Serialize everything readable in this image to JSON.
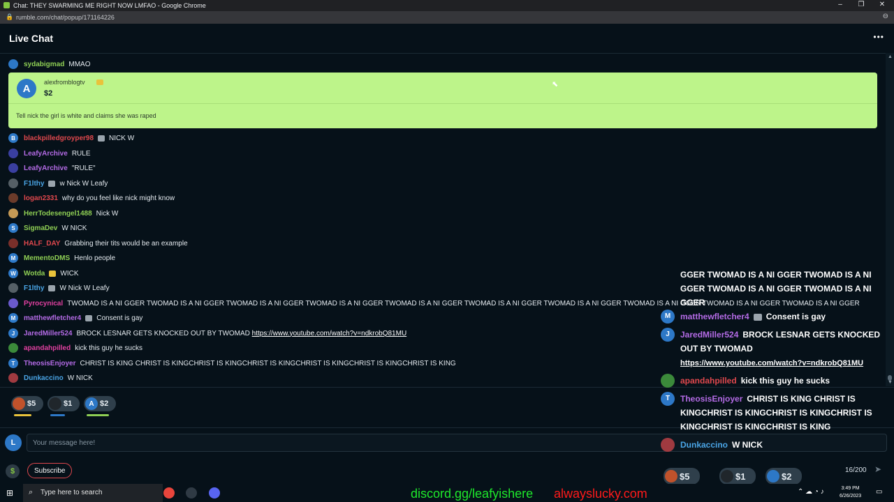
{
  "window": {
    "title": "Chat: THEY SWARMING ME RIGHT NOW LMFAO - Google Chrome",
    "url": "rumble.com/chat/popup/171164226",
    "controls": [
      "–",
      "❐",
      "✕"
    ]
  },
  "header": {
    "title": "Live Chat",
    "more_icon": "more-dots-icon"
  },
  "top_message": {
    "user": "sydabigmad",
    "text": "MMAO",
    "user_color": "#8fcf54"
  },
  "rant": {
    "user": "alexfromblogtv",
    "avatar_letter": "A",
    "amount": "$2",
    "text": "Tell nick the girl is white and claims she was raped",
    "color": "#bdf48a"
  },
  "messages": [
    {
      "avatar": "B",
      "avatar_color": "#2d78c7",
      "user": "blackpilledgroyper98",
      "user_color": "#e0484d",
      "badge": "gray",
      "text": "NICK W"
    },
    {
      "avatar": "",
      "avatar_color": "#3a3fa0",
      "user": "LeafyArchive",
      "user_color": "#b46be6",
      "badge": "",
      "text": "RULE"
    },
    {
      "avatar": "",
      "avatar_color": "#3a3fa0",
      "user": "LeafyArchive",
      "user_color": "#b46be6",
      "badge": "",
      "text": "\"RULE\""
    },
    {
      "avatar": "",
      "avatar_color": "#555f66",
      "user": "F1lthy",
      "user_color": "#4aa5e6",
      "badge": "gray",
      "text": "w Nick W Leafy"
    },
    {
      "avatar": "",
      "avatar_color": "#6b3b2a",
      "user": "logan2331",
      "user_color": "#e0484d",
      "badge": "",
      "text": "why do you feel like nick might know"
    },
    {
      "avatar": "",
      "avatar_color": "#c69a55",
      "user": "HerrTodesengel1488",
      "user_color": "#8fcf54",
      "badge": "",
      "text": "Nick W"
    },
    {
      "avatar": "S",
      "avatar_color": "#2d78c7",
      "user": "SigmaDev",
      "user_color": "#8fcf54",
      "badge": "",
      "text": "W NICK"
    },
    {
      "avatar": "",
      "avatar_color": "#7a2f2a",
      "user": "HALF_DAY",
      "user_color": "#e0484d",
      "badge": "",
      "text": "Grabbing their tits would be an example"
    },
    {
      "avatar": "M",
      "avatar_color": "#2d78c7",
      "user": "MementoDMS",
      "user_color": "#8fcf54",
      "badge": "",
      "text": "Henlo people"
    },
    {
      "avatar": "W",
      "avatar_color": "#2d78c7",
      "user": "Wotda",
      "user_color": "#8fcf54",
      "badge": "gold",
      "text": "WICK"
    },
    {
      "avatar": "",
      "avatar_color": "#555f66",
      "user": "F1lthy",
      "user_color": "#4aa5e6",
      "badge": "gray",
      "text": "W Nick W Leafy"
    },
    {
      "avatar": "",
      "avatar_color": "#6a5acd",
      "user": "Pyrocynical",
      "user_color": "#e040a0",
      "badge": "",
      "text": "TWOMAD IS A NI GGER TWOMAD IS A NI GGER TWOMAD IS A NI GGER TWOMAD IS A NI GGER TWOMAD IS A NI GGER TWOMAD IS A NI GGER TWOMAD IS A NI GGER TWOMAD IS A NI GGER TWOMAD IS A NI GGER TWOMAD IS A NI GGER"
    },
    {
      "avatar": "M",
      "avatar_color": "#2d78c7",
      "user": "matthewfletcher4",
      "user_color": "#b46be6",
      "badge": "gray",
      "text": "Consent is gay"
    },
    {
      "avatar": "J",
      "avatar_color": "#2d78c7",
      "user": "JaredMiller524",
      "user_color": "#b46be6",
      "badge": "",
      "text": "BROCK LESNAR GETS KNOCKED OUT BY TWOMAD",
      "link": "https://www.youtube.com/watch?v=ndkrobQ81MU"
    },
    {
      "avatar": "",
      "avatar_color": "#3b8a3a",
      "user": "apandahpilled",
      "user_color": "#e040a0",
      "badge": "",
      "text": "kick this guy he sucks"
    },
    {
      "avatar": "T",
      "avatar_color": "#2d78c7",
      "user": "TheosisEnjoyer",
      "user_color": "#b46be6",
      "badge": "",
      "text": "CHRIST IS KING CHRIST IS KINGCHRIST IS KINGCHRIST IS KINGCHRIST IS KINGCHRIST IS KINGCHRIST IS KING"
    },
    {
      "avatar": "",
      "avatar_color": "#a03a40",
      "user": "Dunkaccino",
      "user_color": "#4aa5e6",
      "badge": "",
      "text": "W NICK"
    }
  ],
  "pinned_rants": [
    {
      "amount": "$5",
      "avatar": "",
      "avatar_color": "#c0522b",
      "progress": 0.65,
      "bar_color": "#e9c33b"
    },
    {
      "amount": "$1",
      "avatar": "",
      "avatar_color": "#20262b",
      "progress": 0.55,
      "bar_color": "#2d78c7"
    },
    {
      "amount": "$2",
      "avatar": "A",
      "avatar_color": "#2d78c7",
      "progress": 0.85,
      "bar_color": "#8fcf54"
    }
  ],
  "input": {
    "avatar": "L",
    "placeholder": "Your message here!",
    "value": ""
  },
  "footer": {
    "subscribe": "Subscribe",
    "char_count": "16/200",
    "dollar_icon": "$"
  },
  "overlay": {
    "top_text": "GGER TWOMAD IS A NI GGER TWOMAD IS A NI GGER TWOMAD IS A NI GGER TWOMAD IS A NI GGER",
    "messages": [
      {
        "avatar": "M",
        "avatar_color": "#2d78c7",
        "user": "matthewfletcher4",
        "user_color": "#b46be6",
        "badge": true,
        "text": "Consent is gay"
      },
      {
        "avatar": "J",
        "avatar_color": "#2d78c7",
        "user": "JaredMiller524",
        "user_color": "#b46be6",
        "badge": false,
        "text": "BROCK LESNAR GETS KNOCKED OUT BY TWOMAD",
        "link": "https://www.youtube.com/watch?v=ndkrobQ81MU"
      },
      {
        "avatar": "",
        "avatar_color": "#3b8a3a",
        "user": "apandahpilled",
        "user_color": "#e0484d",
        "badge": false,
        "text": "kick this guy he sucks"
      },
      {
        "avatar": "T",
        "avatar_color": "#2d78c7",
        "user": "TheosisEnjoyer",
        "user_color": "#b46be6",
        "badge": false,
        "text": "CHRIST IS KING CHRIST IS KINGCHRIST IS KINGCHRIST IS KINGCHRIST IS KINGCHRIST IS KINGCHRIST IS KING"
      },
      {
        "avatar": "",
        "avatar_color": "#a03a40",
        "user": "Dunkaccino",
        "user_color": "#4aa5e6",
        "badge": false,
        "text": "W NICK"
      }
    ],
    "rants": [
      "$5",
      "$1",
      "$2"
    ]
  },
  "taskbar": {
    "search_text": "Type here to search",
    "time": "3:49 PM",
    "date": "6/26/2023"
  },
  "promo": {
    "discord": "discord.gg/leafyishere",
    "always": "alwayslucky.com",
    "discord_color": "#1ee82b",
    "always_color": "#ff1a1a"
  }
}
